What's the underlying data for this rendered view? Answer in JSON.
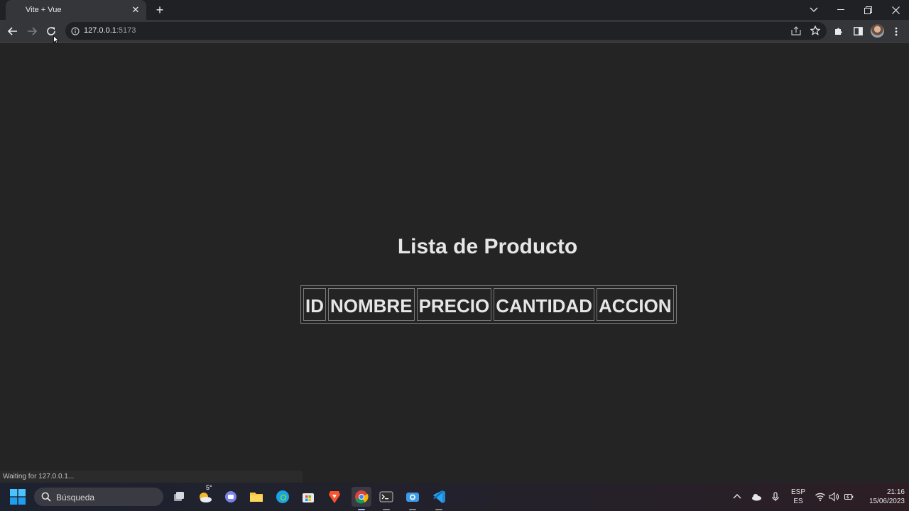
{
  "browser": {
    "tab_title": "Vite + Vue",
    "tab_close": "✕",
    "new_tab": "+",
    "url_host": "127.0.0.1",
    "url_port": ":5173",
    "status_text": "Waiting for 127.0.0.1..."
  },
  "page": {
    "title": "Lista de Producto",
    "table_headers": [
      "ID",
      "NOMBRE",
      "PRECIO",
      "CANTIDAD",
      "ACCION"
    ]
  },
  "taskbar": {
    "search_label": "Búsqueda",
    "weather_temp": "5°",
    "language_top": "ESP",
    "language_bottom": "ES",
    "time": "21:16",
    "date": "15/06/2023"
  },
  "colors": {
    "page_background": "#242424",
    "chrome_dark": "#202124",
    "chrome_toolbar": "#35363a"
  }
}
